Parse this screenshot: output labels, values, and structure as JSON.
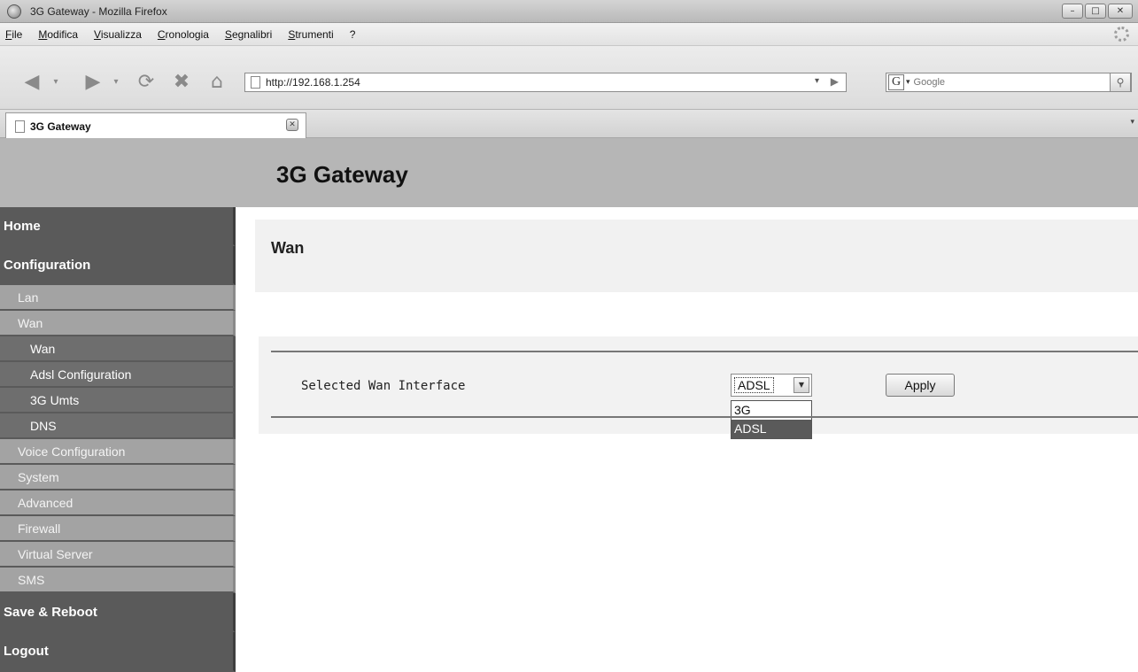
{
  "window": {
    "title": "3G Gateway - Mozilla Firefox"
  },
  "menu": [
    "File",
    "Modifica",
    "Visualizza",
    "Cronologia",
    "Segnalibri",
    "Strumenti",
    "?"
  ],
  "navbar": {
    "url": "http://192.168.1.254",
    "search_placeholder": "Google"
  },
  "tab": {
    "label": "3G Gateway"
  },
  "page": {
    "title": "3G Gateway"
  },
  "sidebar": {
    "home": "Home",
    "configuration": "Configuration",
    "lan": "Lan",
    "wan": "Wan",
    "wan_wan": "Wan",
    "adsl_configuration": "Adsl Configuration",
    "umts": "3G Umts",
    "dns": "DNS",
    "voice_configuration": "Voice Configuration",
    "system": "System",
    "advanced": "Advanced",
    "firewall": "Firewall",
    "virtual_server": "Virtual Server",
    "sms": "SMS",
    "save_reboot": "Save & Reboot",
    "logout": "Logout"
  },
  "main": {
    "section_title": "Wan",
    "field_label": "Selected Wan Interface",
    "select_value": "ADSL",
    "options": [
      "3G",
      "ADSL"
    ],
    "apply_label": "Apply"
  }
}
